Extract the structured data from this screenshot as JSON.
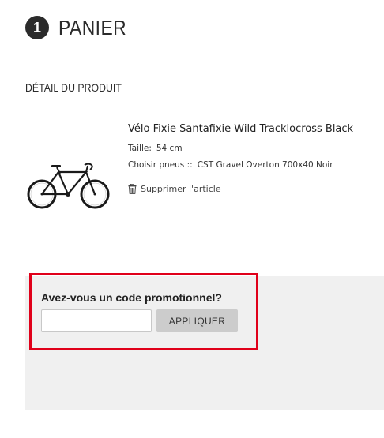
{
  "step": {
    "number": "1",
    "title": "PANIER"
  },
  "section": {
    "title": "DÉTAIL DU PRODUIT"
  },
  "product": {
    "name": "Vélo Fixie Santafixie Wild Tracklocross Black",
    "size_label": "Taille:",
    "size_value": "54 cm",
    "tyres_label": "Choisir pneus ::",
    "tyres_value": "CST Gravel Overton 700x40 Noir",
    "remove_label": "Supprimer l'article",
    "image_icon": "bicycle-image",
    "remove_icon": "trash-icon"
  },
  "promo": {
    "question": "Avez-vous un code promotionnel?",
    "input_value": "",
    "apply_label": "APPLIQUER"
  },
  "colors": {
    "highlight": "#e0001a",
    "panel": "#f0f0f0",
    "button": "#cccccc",
    "step_badge": "#2b2b2b"
  }
}
